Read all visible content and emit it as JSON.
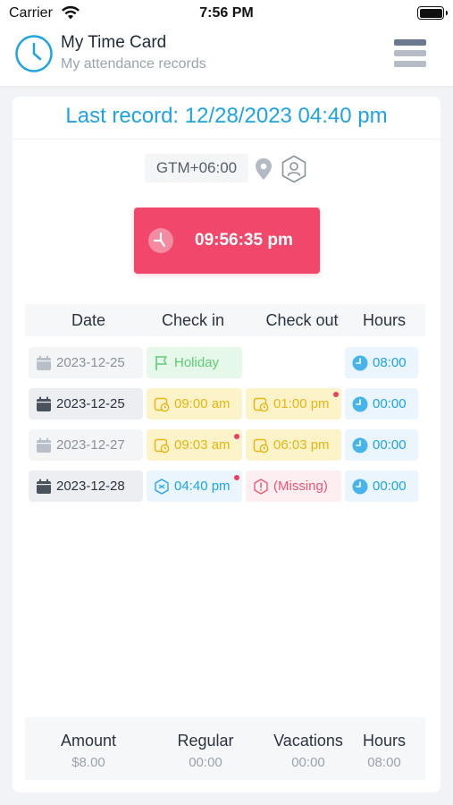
{
  "status_bar": {
    "carrier": "Carrier",
    "time": "7:56 PM"
  },
  "header": {
    "title": "My Time Card",
    "subtitle": "My attendance records",
    "icon": "clock-icon",
    "menu_icon": "menu-icon"
  },
  "last_record": "Last record: 12/28/2023 04:40 pm",
  "timezone": "GTM+06:00",
  "clock_button": {
    "label": "09:56:35 pm",
    "color": "#f0476b"
  },
  "table": {
    "headers": [
      "Date",
      "Check in",
      "Check out",
      "Hours"
    ],
    "rows": [
      {
        "date": "2023-12-25",
        "check_in": "Holiday",
        "check_out": "",
        "hours": "08:00"
      },
      {
        "date": "2023-12-25",
        "check_in": "09:00 am",
        "check_out": "01:00 pm",
        "hours": "00:00"
      },
      {
        "date": "2023-12-27",
        "check_in": "09:03 am",
        "check_out": "06:03 pm",
        "hours": "00:00"
      },
      {
        "date": "2023-12-28",
        "check_in": "04:40 pm",
        "check_out": "(Missing)",
        "hours": "00:00"
      }
    ]
  },
  "summary": {
    "labels": [
      "Amount",
      "Regular",
      "Vacations",
      "Hours"
    ],
    "values": [
      "$8.00",
      "00:00",
      "00:00",
      "08:00"
    ]
  },
  "colors": {
    "accent": "#1ea3e6",
    "danger": "#f0476b",
    "holiday": "#5fcb76",
    "warning": "#e6b512"
  }
}
